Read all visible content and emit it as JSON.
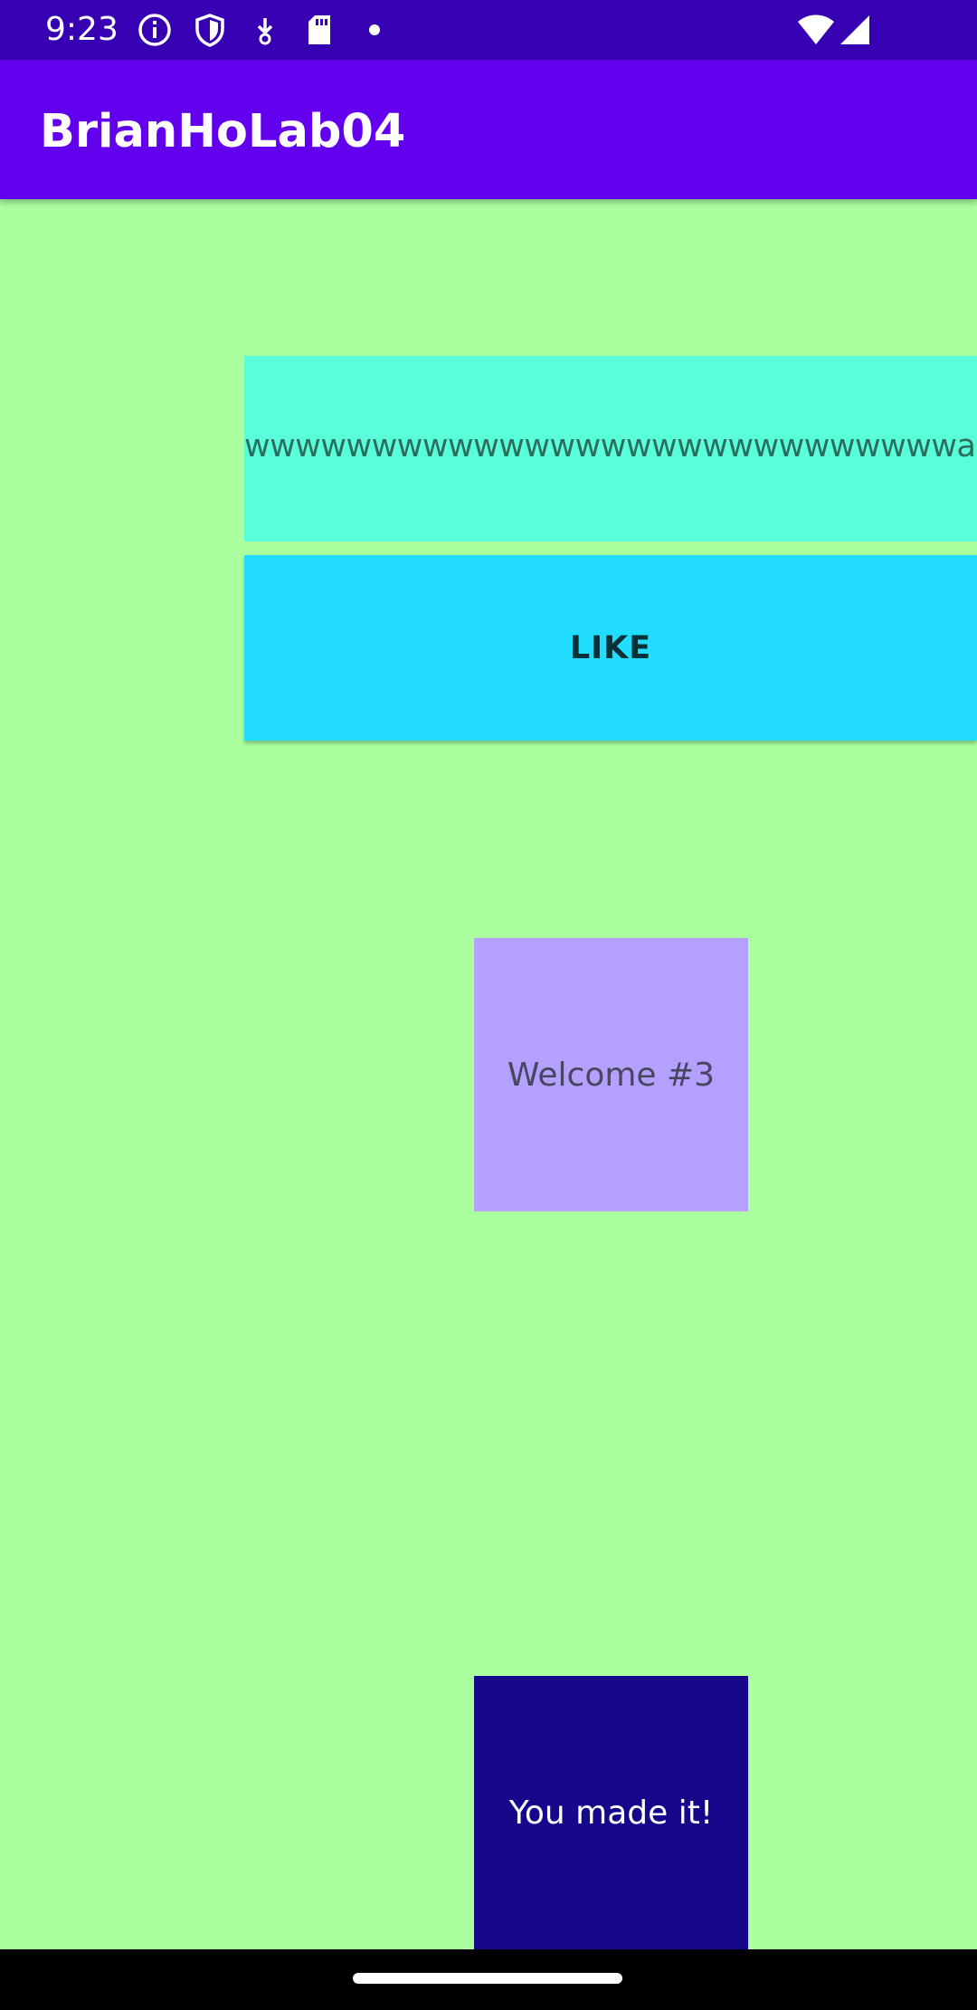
{
  "status_bar": {
    "time": "9:23",
    "icons": [
      "info-icon",
      "shield-icon",
      "download-icon",
      "sd-card-icon",
      "dot-icon",
      "wifi-icon",
      "signal-icon"
    ]
  },
  "app_bar": {
    "title": "BrianHoLab04"
  },
  "main": {
    "text_input_value": "wwwwwwwwwwwwwwwwwwwwwwwwwwwwaduwwwwwwwwwwwwww",
    "like_button_label": "LIKE",
    "welcome_text": "Welcome #3",
    "made_it_text": "You made it!"
  },
  "colors": {
    "status_bar": "#3700b3",
    "app_bar": "#6200ee",
    "background": "#abff9f",
    "input_background": "#59ffd9",
    "button_background": "#22ddff",
    "welcome_background": "#b4a0ff",
    "made_it_background": "#16078b",
    "nav_bar": "#000000"
  }
}
